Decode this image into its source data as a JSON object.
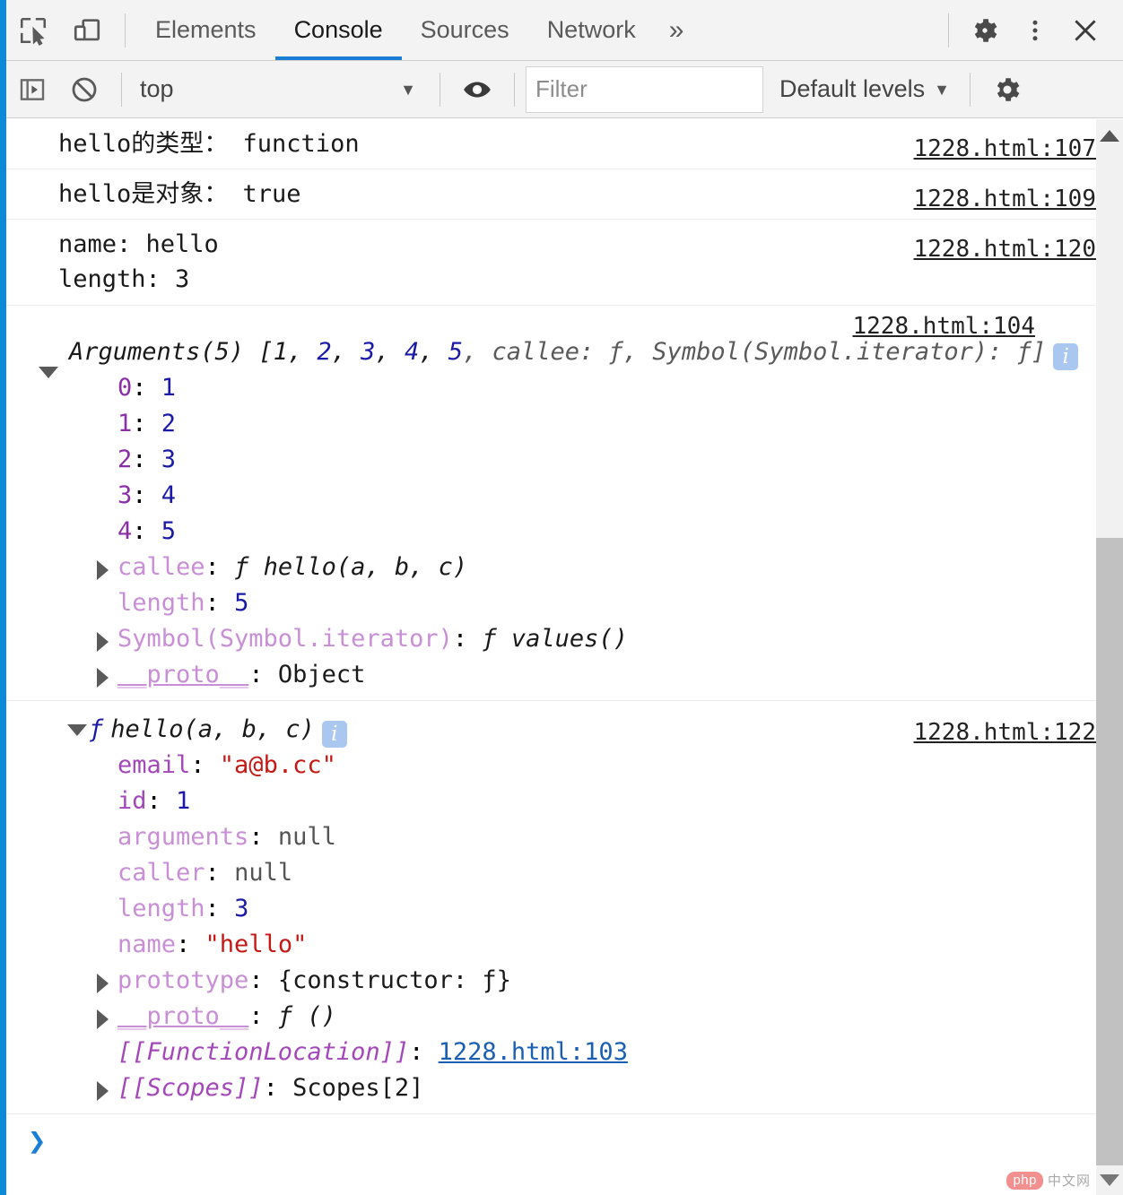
{
  "devtools": {
    "tabs": [
      {
        "label": "Elements",
        "active": false
      },
      {
        "label": "Console",
        "active": true
      },
      {
        "label": "Sources",
        "active": false
      },
      {
        "label": "Network",
        "active": false
      }
    ],
    "more_tabs_label": "»",
    "icons": {
      "inspect": "inspect-element-icon",
      "device": "device-toolbar-icon",
      "settings": "gear-icon",
      "kebab": "more-options-icon",
      "close": "close-icon"
    }
  },
  "console_toolbar": {
    "sidebar_toggle_label": "console-sidebar-icon",
    "clear_label": "clear-console-icon",
    "context_selected": "top",
    "context_caret": "▼",
    "live_expression_label": "eye-icon",
    "filter_placeholder": "Filter",
    "filter_value": "",
    "levels_label": "Default levels",
    "levels_caret": "▼",
    "settings_label": "console-settings-icon"
  },
  "messages": [
    {
      "id": "msg-type",
      "text": "hello的类型： function",
      "source": "1228.html:107"
    },
    {
      "id": "msg-isobject",
      "text": "hello是对象： true",
      "source": "1228.html:109"
    },
    {
      "id": "msg-name-length",
      "text": "name: hello\nlength: 3",
      "source": "1228.html:120"
    }
  ],
  "arguments_group": {
    "source": "1228.html:104",
    "header": {
      "label": "Arguments(5)",
      "bracket_open": " [",
      "values": [
        "1",
        "2",
        "3",
        "4",
        "5"
      ],
      "extra": ", callee: ƒ, Symbol(Symbol.iterator): ƒ]",
      "expanded": true
    },
    "properties": [
      {
        "name": "0",
        "value": "1",
        "kind": "number",
        "expandable": false
      },
      {
        "name": "1",
        "value": "2",
        "kind": "number",
        "expandable": false
      },
      {
        "name": "2",
        "value": "3",
        "kind": "number",
        "expandable": false
      },
      {
        "name": "3",
        "value": "4",
        "kind": "number",
        "expandable": false
      },
      {
        "name": "4",
        "value": "5",
        "kind": "number",
        "expandable": false
      },
      {
        "name": "callee",
        "value": "ƒ hello(a, b, c)",
        "kind": "function",
        "expandable": true
      },
      {
        "name": "length",
        "value": "5",
        "kind": "number",
        "expandable": false
      },
      {
        "name": "Symbol(Symbol.iterator)",
        "value": "ƒ values()",
        "kind": "function",
        "expandable": true
      },
      {
        "name": "__proto__",
        "value": "Object",
        "kind": "object",
        "expandable": true
      }
    ]
  },
  "function_group": {
    "source": "1228.html:122",
    "header": {
      "fn_glyph": "ƒ",
      "signature": "hello(a, b, c)",
      "expanded": true
    },
    "properties": [
      {
        "name": "email",
        "value": "\"a@b.cc\"",
        "kind": "string",
        "expandable": false
      },
      {
        "name": "id",
        "value": "1",
        "kind": "number",
        "expandable": false
      },
      {
        "name": "arguments",
        "value": "null",
        "kind": "null",
        "expandable": false,
        "dim": true
      },
      {
        "name": "caller",
        "value": "null",
        "kind": "null",
        "expandable": false,
        "dim": true
      },
      {
        "name": "length",
        "value": "3",
        "kind": "number",
        "expandable": false,
        "dim": true
      },
      {
        "name": "name",
        "value": "\"hello\"",
        "kind": "string",
        "expandable": false,
        "dim": true
      },
      {
        "name": "prototype",
        "value": "{constructor: ƒ}",
        "kind": "object",
        "expandable": true,
        "dim": true
      },
      {
        "name": "__proto__",
        "value": "ƒ ()",
        "kind": "function",
        "expandable": true,
        "dim": true
      },
      {
        "name": "[[FunctionLocation]]",
        "value": "1228.html:103",
        "kind": "link",
        "expandable": false,
        "internal": true
      },
      {
        "name": "[[Scopes]]",
        "value": "Scopes[2]",
        "kind": "object",
        "expandable": true,
        "internal": true
      }
    ]
  },
  "prompt": {
    "caret": "❯",
    "value": ""
  },
  "watermark": {
    "brand": "php",
    "suffix": "中文网"
  },
  "colors": {
    "accent_blue": "#0a8ad8",
    "tab_active_underline": "#1a7fd4",
    "property_purple": "#a347ba",
    "number_blue": "#1a1aa6",
    "string_red": "#c41a16",
    "toolbar_bg": "#f3f3f3"
  }
}
